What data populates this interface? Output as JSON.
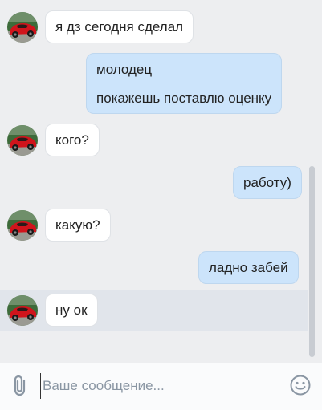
{
  "messages": [
    {
      "direction": "in",
      "text": "я дз сегодня сделал"
    },
    {
      "direction": "out",
      "lines": [
        "молодец",
        "покажешь поставлю оценку"
      ]
    },
    {
      "direction": "in",
      "text": "кого?"
    },
    {
      "direction": "out",
      "text": "работу)"
    },
    {
      "direction": "in",
      "text": "какую?"
    },
    {
      "direction": "out",
      "text": "ладно забей"
    },
    {
      "direction": "in",
      "text": "ну ок"
    }
  ],
  "composer": {
    "placeholder": "Ваше сообщение..."
  },
  "icons": {
    "attach": "paperclip-icon",
    "emoji": "smiley-icon",
    "avatar": "red-car-avatar"
  },
  "colors": {
    "incoming_bubble": "#ffffff",
    "outgoing_bubble": "#cce4fb",
    "background": "#edeef0"
  }
}
